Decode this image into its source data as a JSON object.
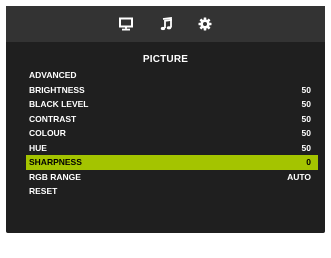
{
  "tabs": [
    {
      "icon": "monitor-icon",
      "active": true
    },
    {
      "icon": "music-note-icon",
      "active": false
    },
    {
      "icon": "gear-icon",
      "active": false
    }
  ],
  "colors": {
    "panel": "#1f1f1f",
    "tabbar": "#333333",
    "text": "#ffffff",
    "selection": "#a4c400"
  },
  "menu": {
    "title": "PICTURE",
    "items": [
      {
        "label": "ADVANCED",
        "value": ""
      },
      {
        "label": "BRIGHTNESS",
        "value": "50"
      },
      {
        "label": "BLACK LEVEL",
        "value": "50"
      },
      {
        "label": "CONTRAST",
        "value": "50"
      },
      {
        "label": "COLOUR",
        "value": "50"
      },
      {
        "label": "HUE",
        "value": "50"
      },
      {
        "label": "SHARPNESS",
        "value": "0"
      },
      {
        "label": "RGB RANGE",
        "value": "AUTO"
      },
      {
        "label": "RESET",
        "value": ""
      }
    ],
    "selected": "SHARPNESS"
  }
}
